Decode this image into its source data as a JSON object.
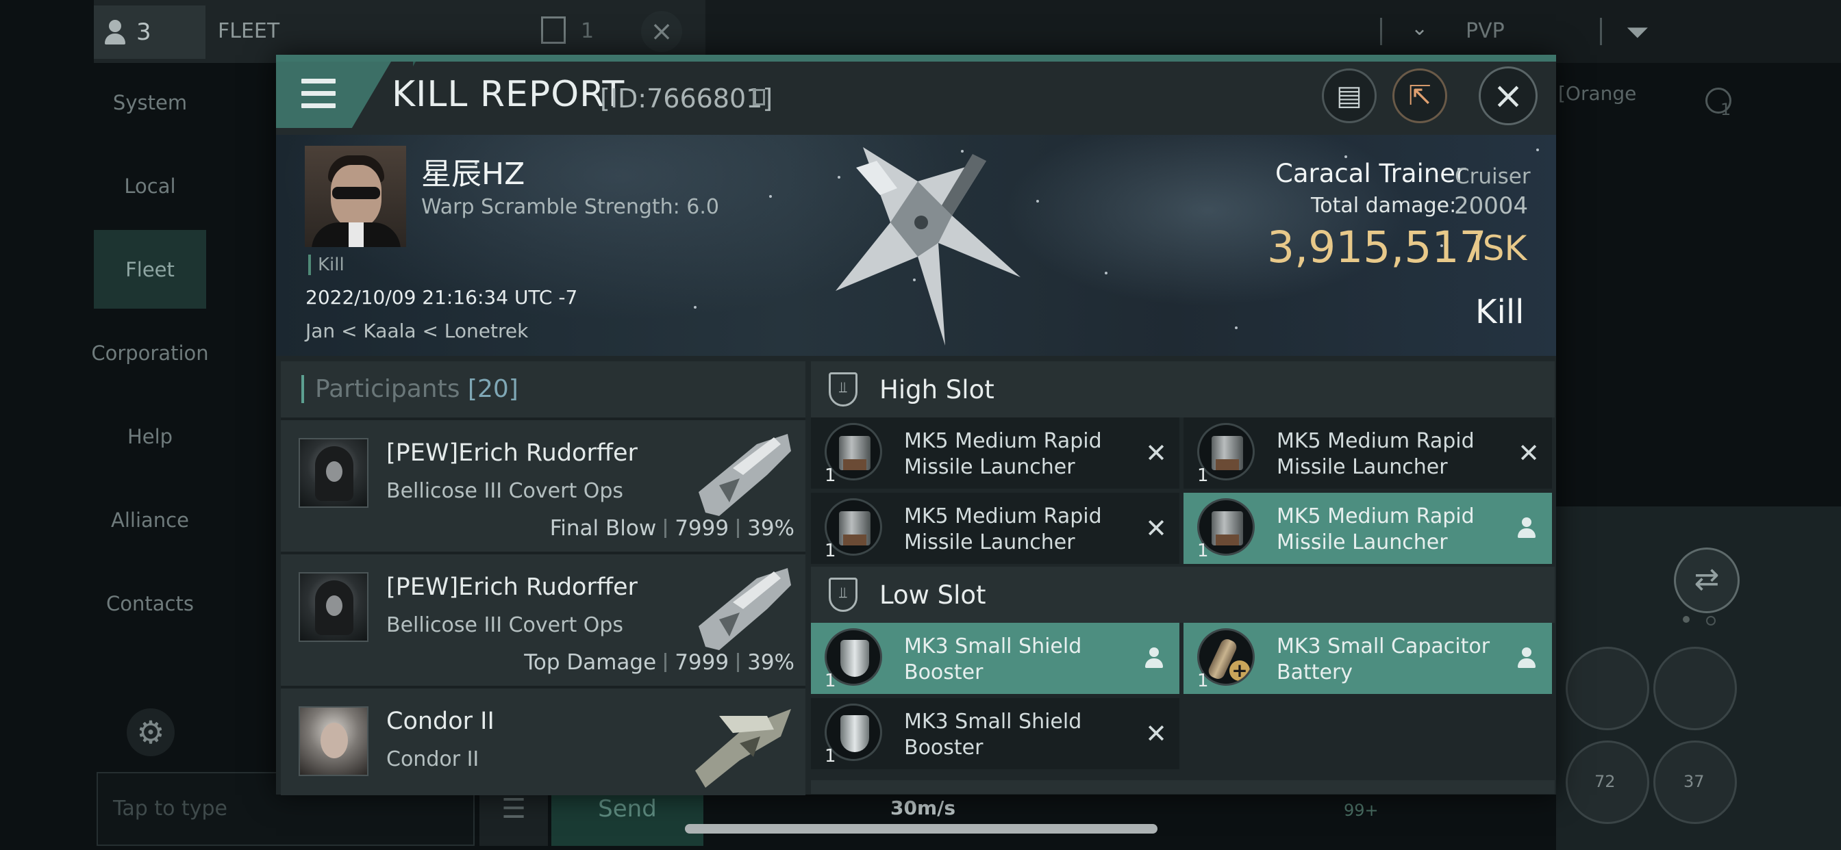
{
  "background": {
    "member_count": "3",
    "fleet_label": "FLEET",
    "box_count": "1",
    "channel_filter": "PVP",
    "sidebar": [
      "System",
      "Local",
      "Fleet",
      "Corporation",
      "Help",
      "Alliance",
      "Contacts"
    ],
    "input_placeholder": "Tap to type",
    "send_label": "Send",
    "right_tag": "[Orange",
    "right_icon_count": "1",
    "speed": "30m/s",
    "module_counts": [
      "72",
      "37"
    ],
    "badge": "99+"
  },
  "report": {
    "title": "KILL REPORT",
    "id": "[ID:7666801]",
    "victim": {
      "name": "星辰HZ",
      "warp": "Warp Scramble Strength: 6.0",
      "tag": "Kill",
      "date": "2022/10/09 21:16:34 UTC -7",
      "location": "Jan < Kaala < Lonetrek"
    },
    "ship": {
      "name": "Caracal Trainer",
      "class": "Cruiser",
      "damage_label": "Total damage:",
      "damage_value": "20004",
      "isk_value": "3,915,517",
      "isk_unit": "ISK",
      "result": "Kill"
    },
    "participants": {
      "title": "Participants",
      "count": "[20]",
      "list": [
        {
          "name": "[PEW]Erich Rudorffer",
          "ship": "Bellicose III Covert Ops",
          "role": "Final Blow",
          "damage": "7999",
          "percent": "39%"
        },
        {
          "name": "[PEW]Erich Rudorffer",
          "ship": "Bellicose III Covert Ops",
          "role": "Top Damage",
          "damage": "7999",
          "percent": "39%"
        },
        {
          "name": "Condor II",
          "ship": "Condor II",
          "role": "",
          "damage": "",
          "percent": ""
        }
      ]
    },
    "high_slot": {
      "title": "High Slot",
      "modules": [
        {
          "name": "MK5 Medium Rapid Missile Launcher",
          "qty": "1",
          "status": "destroyed"
        },
        {
          "name": "MK5 Medium Rapid Missile Launcher",
          "qty": "1",
          "status": "destroyed"
        },
        {
          "name": "MK5 Medium Rapid Missile Launcher",
          "qty": "1",
          "status": "destroyed"
        },
        {
          "name": "MK5 Medium Rapid Missile Launcher",
          "qty": "1",
          "status": "dropped"
        }
      ]
    },
    "low_slot": {
      "title": "Low Slot",
      "modules": [
        {
          "name": "MK3 Small Shield Booster",
          "qty": "1",
          "status": "dropped"
        },
        {
          "name": "MK3 Small Capacitor Battery",
          "qty": "1",
          "status": "dropped"
        },
        {
          "name": "MK3 Small Shield Booster",
          "qty": "1",
          "status": "destroyed"
        }
      ]
    }
  }
}
